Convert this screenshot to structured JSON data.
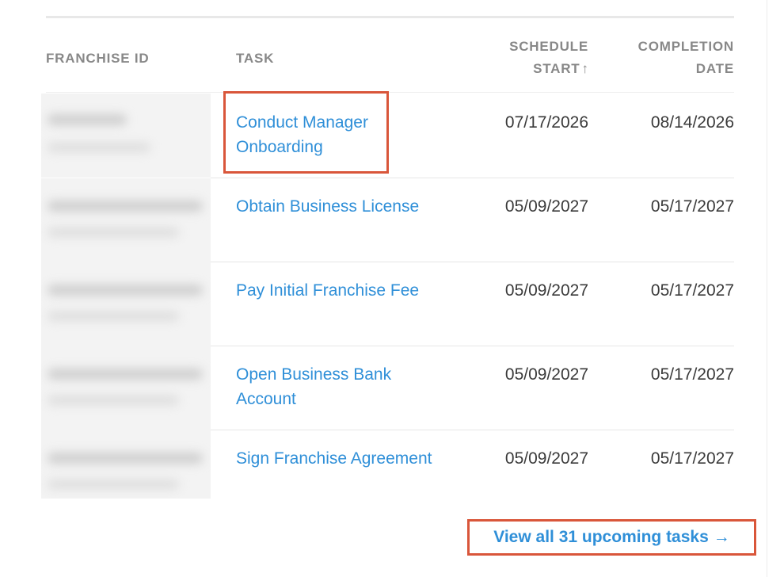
{
  "table": {
    "headers": {
      "franchise_id": "FRANCHISE ID",
      "task": "TASK",
      "schedule_start_line1": "SCHEDULE",
      "schedule_start_line2": "START",
      "sort_indicator": "↑",
      "completion_line1": "COMPLETION",
      "completion_line2": "DATE"
    },
    "rows": [
      {
        "task": "Conduct Manager Onboarding",
        "task_line1": "Conduct Manager",
        "task_line2": "Onboarding",
        "schedule_start": "07/17/2026",
        "completion_date": "08/14/2026"
      },
      {
        "task": "Obtain Business License",
        "task_line1": "Obtain Business License",
        "task_line2": "",
        "schedule_start": "05/09/2027",
        "completion_date": "05/17/2027"
      },
      {
        "task": "Pay Initial Franchise Fee",
        "task_line1": "Pay Initial Franchise Fee",
        "task_line2": "",
        "schedule_start": "05/09/2027",
        "completion_date": "05/17/2027"
      },
      {
        "task": "Open Business Bank Account",
        "task_line1": "Open Business Bank",
        "task_line2": "Account",
        "schedule_start": "05/09/2027",
        "completion_date": "05/17/2027"
      },
      {
        "task": "Sign Franchise Agreement",
        "task_line1": "Sign Franchise Agreement",
        "task_line2": "",
        "schedule_start": "05/09/2027",
        "completion_date": "05/17/2027"
      }
    ]
  },
  "footer": {
    "view_all_label": "View all 31 upcoming tasks",
    "arrow": "→"
  },
  "colors": {
    "link": "#2f8fd8",
    "highlight": "#d9563a",
    "header_text": "#888888"
  }
}
